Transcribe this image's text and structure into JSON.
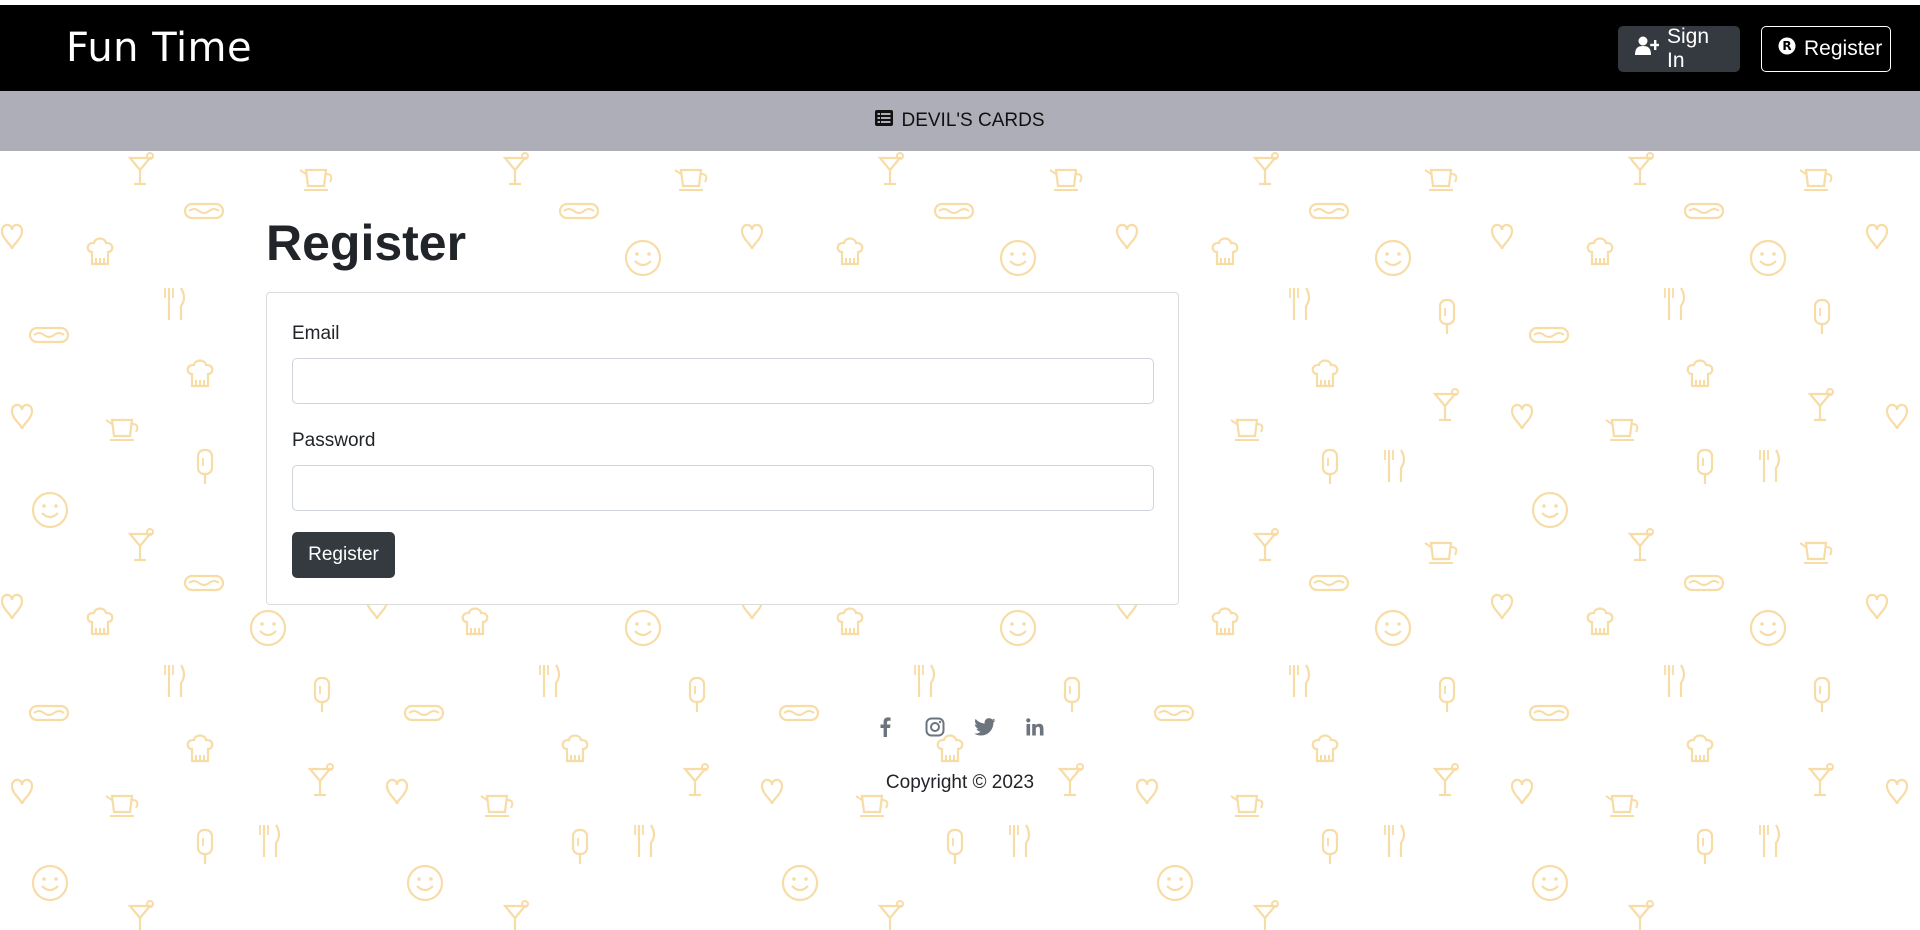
{
  "navbar": {
    "brand": "Fun Time",
    "sign_in_label": "Sign In",
    "register_label": "Register"
  },
  "subnav": {
    "link_label": "DEVIL'S CARDS"
  },
  "page": {
    "title": "Register"
  },
  "form": {
    "email_label": "Email",
    "email_value": "",
    "password_label": "Password",
    "password_value": "",
    "submit_label": "Register"
  },
  "footer": {
    "social_icons": [
      "facebook-icon",
      "instagram-icon",
      "twitter-icon",
      "linkedin-icon"
    ],
    "copyright": "Copyright © 2023"
  },
  "colors": {
    "navbar_bg": "#000000",
    "subnav_bg": "#aeaeb8",
    "button_dark": "#343a40",
    "pattern": "#f7dca6"
  }
}
